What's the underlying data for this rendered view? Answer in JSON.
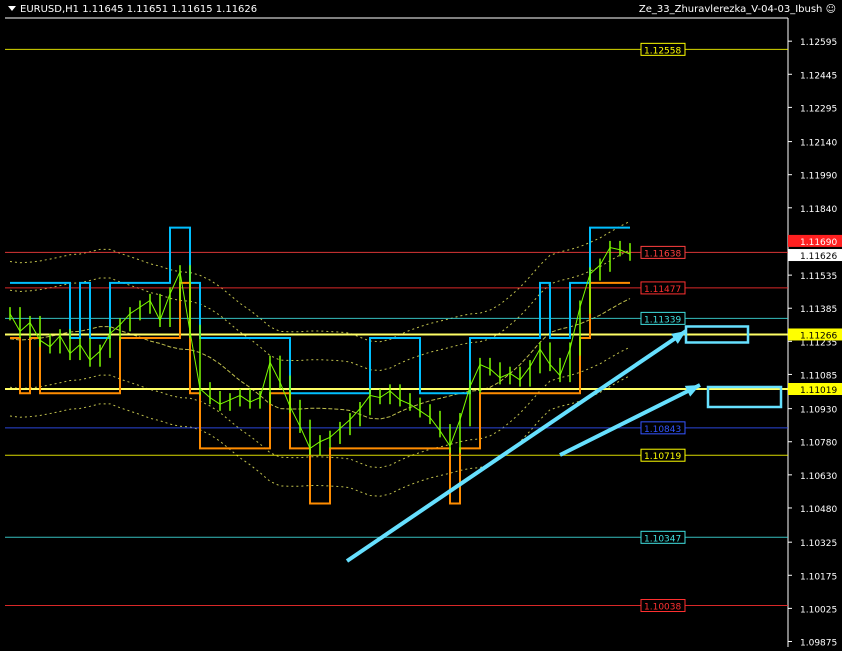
{
  "header": {
    "symbol_line": "EURUSD,H1  1.11645 1.11651 1.11615 1.11626",
    "indicator": "Ze_33_Zhuravlerezka_V-04-03_Ibush",
    "smiley_icon": "smiley-icon"
  },
  "chart_data": {
    "type": "line",
    "title": "",
    "xlabel": "",
    "ylabel": "",
    "ylim": [
      1.0985,
      1.127
    ],
    "y_ticks": [
      "1.12595",
      "1.12445",
      "1.12295",
      "1.12140",
      "1.11990",
      "1.11840",
      "1.11690",
      "1.11535",
      "1.11385",
      "1.11235",
      "1.11085",
      "1.10930",
      "1.10780",
      "1.10630",
      "1.10480",
      "1.10325",
      "1.10175",
      "1.10025",
      "1.09875"
    ],
    "price_tags": [
      {
        "text": "1.11626",
        "value": 1.11626,
        "bg": "#ffffff",
        "fg": "#000000"
      },
      {
        "text": "1.11690",
        "value": 1.1169,
        "bg": "#ff2020",
        "fg": "#ffffff"
      },
      {
        "text": "1.11266",
        "value": 1.11266,
        "bg": "#ffff00",
        "fg": "#000000"
      },
      {
        "text": "1.11019",
        "value": 1.11019,
        "bg": "#ffff00",
        "fg": "#000000"
      }
    ],
    "levels": [
      {
        "label": "1.12558",
        "value": 1.12558,
        "color": "#ffff00"
      },
      {
        "label": "1.11638",
        "value": 1.11638,
        "color": "#ff4040"
      },
      {
        "label": "1.11477",
        "value": 1.11477,
        "color": "#ff3030"
      },
      {
        "label": "1.11339",
        "value": 1.11339,
        "color": "#40e0e0"
      },
      {
        "label": "1.10843",
        "value": 1.10843,
        "color": "#3355ff"
      },
      {
        "label": "1.10719",
        "value": 1.10719,
        "color": "#ffff00"
      },
      {
        "label": "1.10347",
        "value": 1.10347,
        "color": "#40e0e0"
      },
      {
        "label": "1.10038",
        "value": 1.10038,
        "color": "#ff3030"
      }
    ],
    "bold_levels": [
      {
        "value": 1.11266,
        "color": "#ffff66"
      },
      {
        "value": 1.11019,
        "color": "#ffff66"
      }
    ],
    "price_series": {
      "name": "",
      "color": "#7cfc00",
      "values": [
        1.1136,
        1.1128,
        1.1132,
        1.1124,
        1.1121,
        1.1126,
        1.1118,
        1.1122,
        1.1115,
        1.1119,
        1.1127,
        1.1131,
        1.1136,
        1.1139,
        1.1142,
        1.1133,
        1.1145,
        1.1155,
        1.1128,
        1.1102,
        1.1098,
        1.1095,
        1.1097,
        1.1099,
        1.1096,
        1.1098,
        1.1114,
        1.1105,
        1.1094,
        1.1085,
        1.1075,
        1.1078,
        1.108,
        1.1084,
        1.1088,
        1.1093,
        1.1099,
        1.1098,
        1.1101,
        1.1097,
        1.1095,
        1.1092,
        1.1089,
        1.1083,
        1.1076,
        1.1088,
        1.1103,
        1.1113,
        1.1111,
        1.1107,
        1.1109,
        1.1106,
        1.1112,
        1.112,
        1.1113,
        1.1108,
        1.112,
        1.1139,
        1.1154,
        1.1158,
        1.1166,
        1.1165,
        1.1163
      ]
    },
    "accent_colors": {
      "resistance": "#00bfff",
      "support": "#ff8c00",
      "envelope": "#ffff66",
      "arrows": "#66e0ff"
    }
  }
}
